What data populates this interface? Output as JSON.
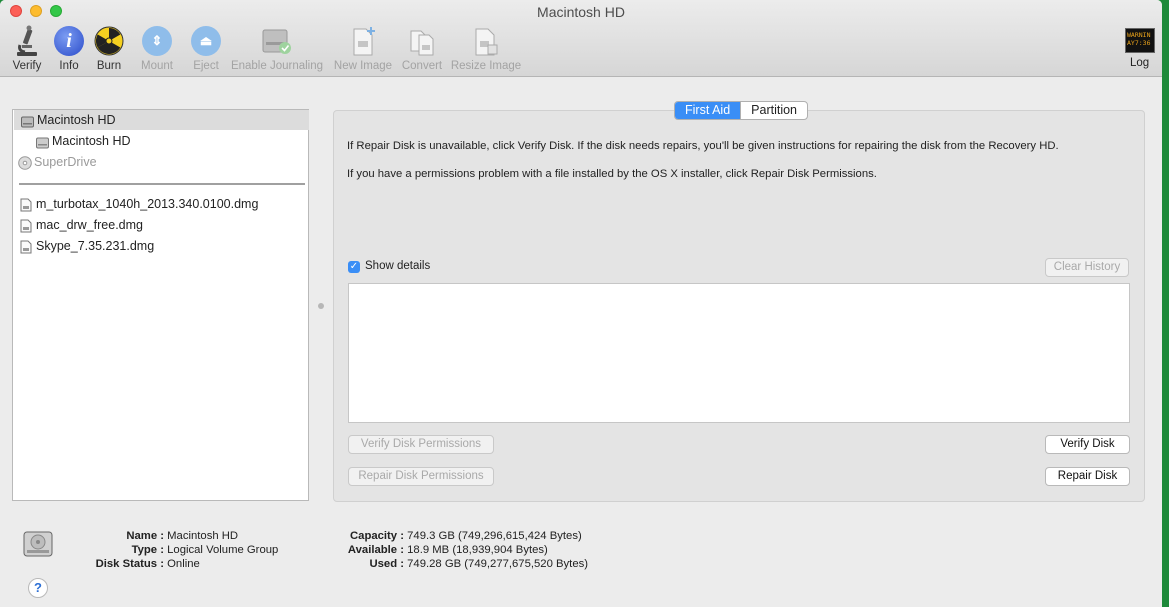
{
  "window": {
    "title": "Macintosh HD"
  },
  "toolbar": {
    "verify": "Verify",
    "info": "Info",
    "burn": "Burn",
    "mount": "Mount",
    "eject": "Eject",
    "enable_journaling": "Enable Journaling",
    "new_image": "New Image",
    "convert": "Convert",
    "resize_image": "Resize Image",
    "log": "Log",
    "log_icon_text": "WARNIN AY7:36"
  },
  "sidebar": {
    "items": [
      {
        "label": "Macintosh HD",
        "icon": "drive-icon",
        "selected": true
      },
      {
        "label": "Macintosh HD",
        "icon": "volume-icon"
      },
      {
        "label": "SuperDrive",
        "icon": "optical-drive-icon",
        "dimmed": true
      },
      {
        "label": "m_turbotax_1040h_2013.340.0100.dmg",
        "icon": "dmg-icon"
      },
      {
        "label": "mac_drw_free.dmg",
        "icon": "dmg-icon"
      },
      {
        "label": "Skype_7.35.231.dmg",
        "icon": "dmg-icon"
      }
    ]
  },
  "tabs": {
    "first_aid": "First Aid",
    "partition": "Partition",
    "active": "first_aid"
  },
  "first_aid": {
    "line1": "If Repair Disk is unavailable, click Verify Disk. If the disk needs repairs, you'll be given instructions for repairing the disk from the Recovery HD.",
    "line2": "If you have a permissions problem with a file installed by the OS X installer, click Repair Disk Permissions.",
    "show_details": "Show details",
    "show_details_checked": true,
    "clear_history": "Clear History",
    "verify_permissions": "Verify Disk Permissions",
    "repair_permissions": "Repair Disk Permissions",
    "verify_disk": "Verify Disk",
    "repair_disk": "Repair Disk"
  },
  "info": {
    "name_key": "Name :",
    "name_val": "Macintosh HD",
    "type_key": "Type :",
    "type_val": "Logical Volume Group",
    "status_key": "Disk Status :",
    "status_val": "Online",
    "capacity_key": "Capacity :",
    "capacity_val": "749.3 GB (749,296,615,424 Bytes)",
    "available_key": "Available :",
    "available_val": "18.9 MB (18,939,904 Bytes)",
    "used_key": "Used :",
    "used_val": "749.28 GB (749,277,675,520 Bytes)"
  },
  "help": "?",
  "colors": {
    "accent": "#3a8ef6",
    "desktop": "#1e8a3a"
  }
}
